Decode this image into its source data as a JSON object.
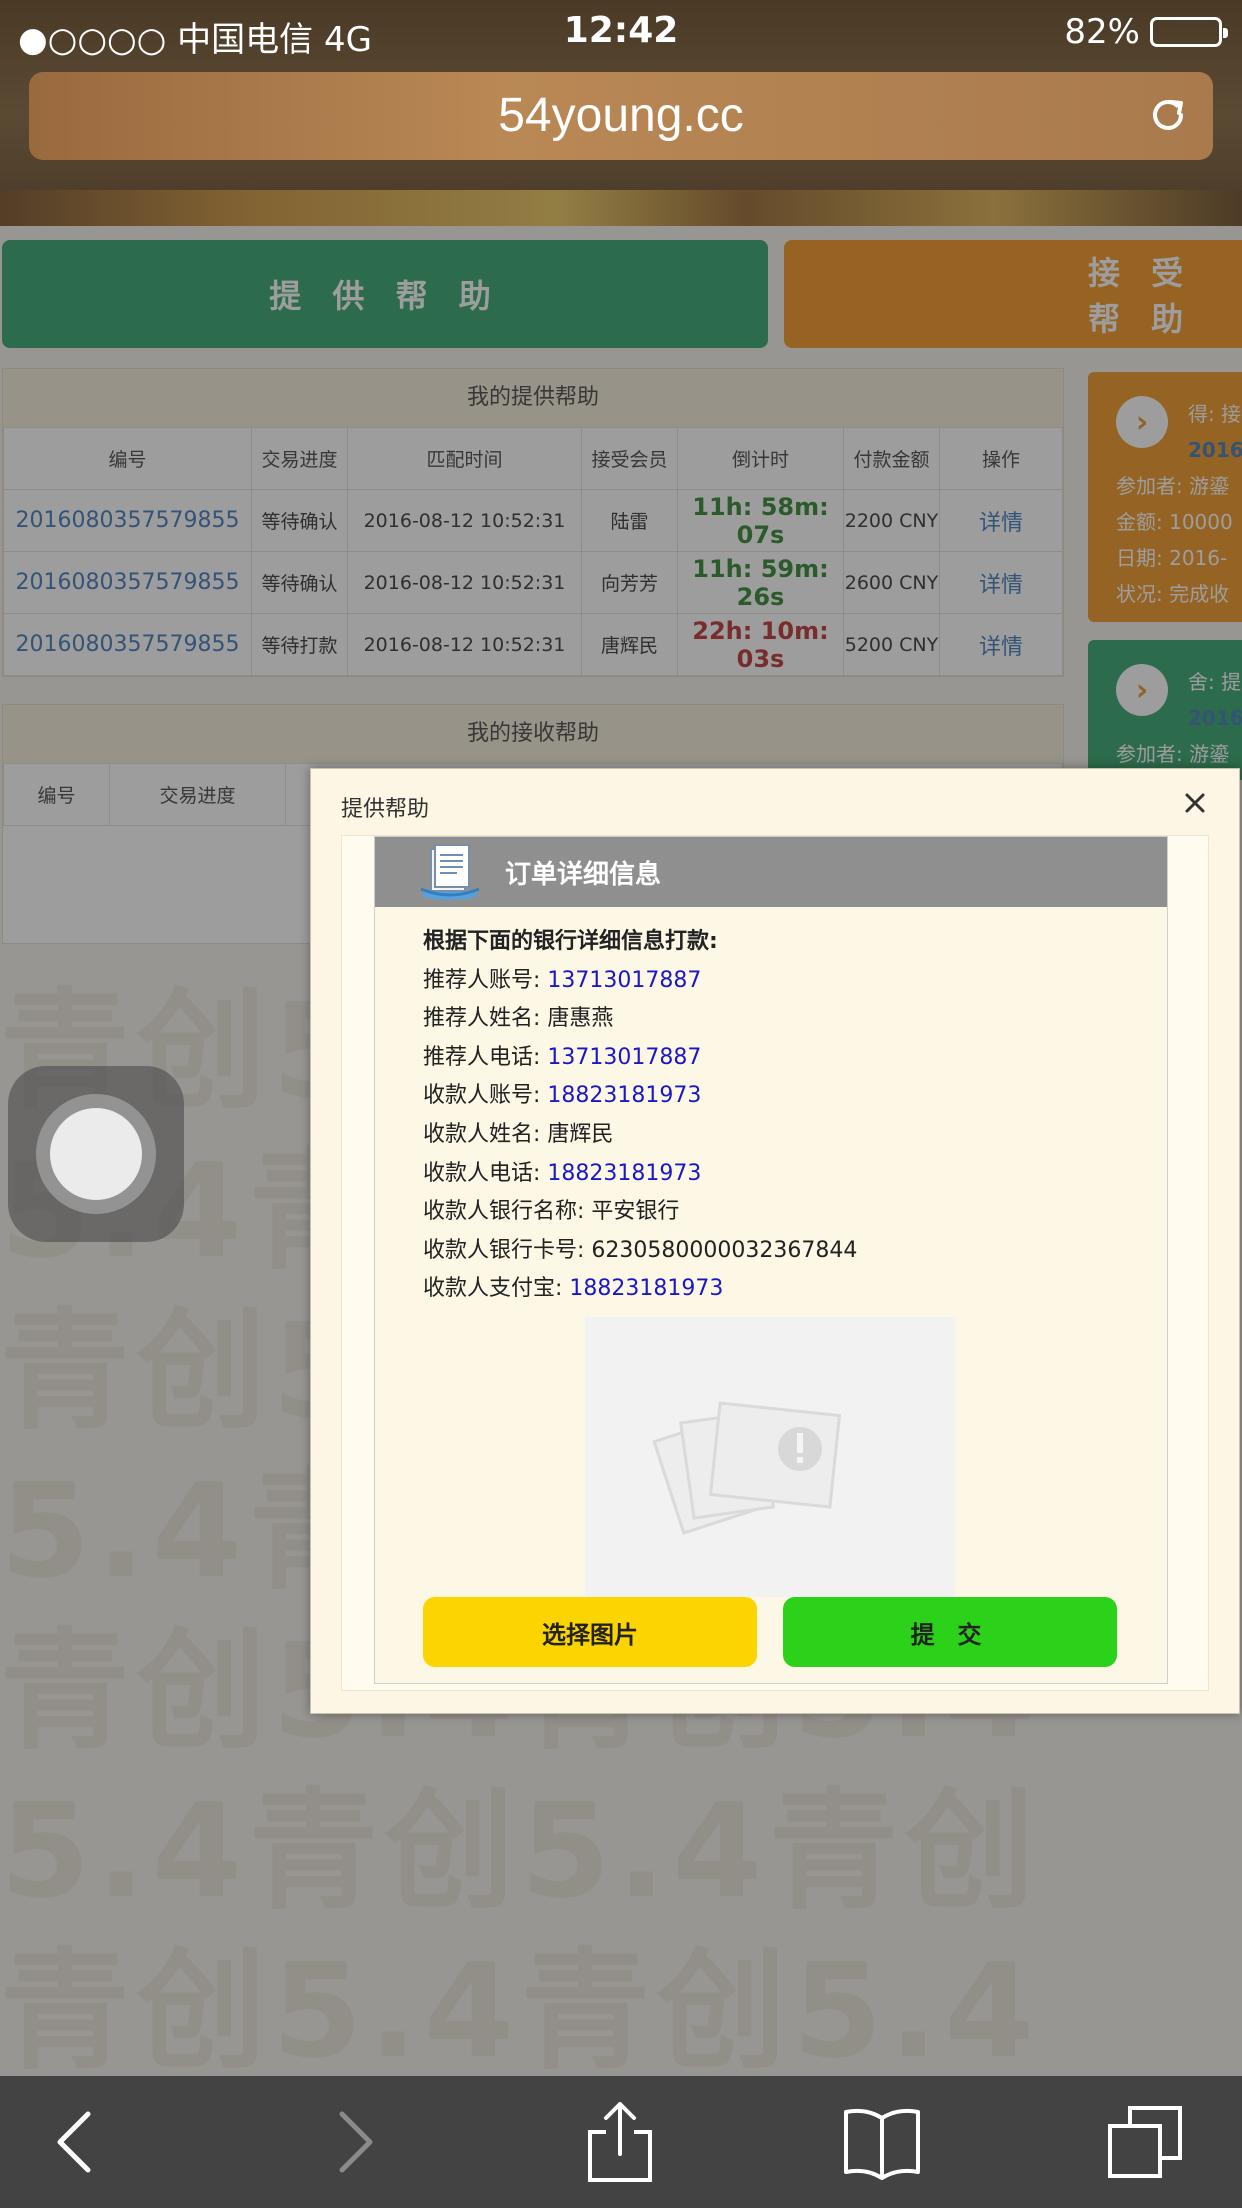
{
  "status_bar": {
    "carrier": "●○○○○ 中国电信   4G",
    "time": "12:42",
    "battery": "82%",
    "battery_level": 0.82
  },
  "browser": {
    "url": "54young.cc"
  },
  "page": {
    "provide_button": "提 供 帮 助",
    "receive_button": "接 受 帮 助",
    "my_provide": {
      "title": "我的提供帮助",
      "headers": [
        "编号",
        "交易进度",
        "匹配时间",
        "接受会员",
        "倒计时",
        "付款金额",
        "操作"
      ],
      "rows": [
        {
          "id": "2016080357579855",
          "status": "等待确认",
          "time": "2016-08-12 10:52:31",
          "member": "陆雷",
          "countdown": "11h: 58m: 07s",
          "amount": "2200 CNY",
          "action": "详情"
        },
        {
          "id": "2016080357579855",
          "status": "等待确认",
          "time": "2016-08-12 10:52:31",
          "member": "向芳芳",
          "countdown": "11h: 59m: 26s",
          "amount": "2600 CNY",
          "action": "详情"
        },
        {
          "id": "2016080357579855",
          "status": "等待打款",
          "time": "2016-08-12 10:52:31",
          "member": "唐辉民",
          "countdown": "22h: 10m: 03s",
          "amount": "5200 CNY",
          "action": "详情"
        }
      ]
    },
    "my_receive": {
      "title": "我的接收帮助",
      "headers": [
        "编号",
        "交易进度"
      ]
    },
    "side_card_1": {
      "line1": "得: 接",
      "line1b": "2016",
      "participant": "参加者: 游鎏",
      "amount": "金额: 10000",
      "date": "日期: 2016-",
      "status": "状况: 完成收"
    },
    "side_card_2": {
      "line1": "舍: 提",
      "line1b": "2016",
      "participant": "参加者: 游鎏"
    },
    "watermark_rows": [
      "青创5.4青创5.4",
      "5.4青创5.4青创",
      "青创5.4青创5.4",
      "5.4青创5.4青创",
      "青创5.4青创5.4",
      "5.4青创5.4青创",
      "青创5.4青创5.4"
    ]
  },
  "modal": {
    "title": "提供帮助",
    "order_title": "订单详细信息",
    "instruction": "根据下面的银行详细信息打款:",
    "fields": [
      {
        "label": "推荐人账号:",
        "value": "13713017887",
        "blue": true
      },
      {
        "label": "推荐人姓名:",
        "value": "唐惠燕",
        "blue": false
      },
      {
        "label": "推荐人电话:",
        "value": "13713017887",
        "blue": true
      },
      {
        "label": "收款人账号:",
        "value": "18823181973",
        "blue": true
      },
      {
        "label": "收款人姓名:",
        "value": "唐辉民",
        "blue": false
      },
      {
        "label": "收款人电话:",
        "value": "18823181973",
        "blue": true
      },
      {
        "label": "收款人银行名称:",
        "value": "平安银行",
        "blue": false
      },
      {
        "label": "收款人银行卡号:",
        "value": "6230580000032367844",
        "blue": false
      },
      {
        "label": "收款人支付宝:",
        "value": "18823181973",
        "blue": true
      }
    ],
    "choose_button": "选择图片",
    "submit_button": "提 交"
  }
}
